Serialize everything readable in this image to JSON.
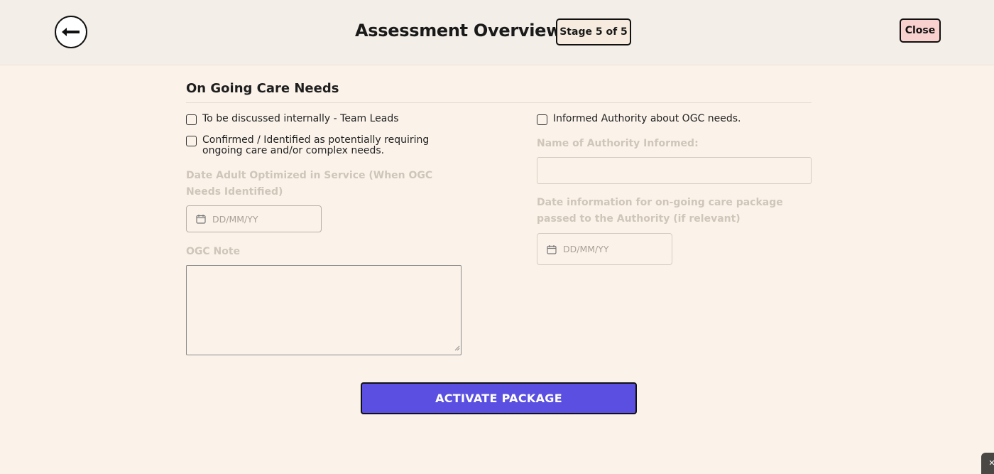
{
  "header": {
    "title": "Assessment Overview",
    "stage": "Stage 5 of 5",
    "close_label": "Close"
  },
  "section": {
    "title": "On Going Care Needs"
  },
  "left": {
    "check_internal": "To be discussed internally - Team Leads",
    "check_confirmed": "Confirmed / Identified as potentially requiring ongoing care and/or complex needs.",
    "date_optimized_label": "Date Adult Optimized in Service (When OGC Needs Identified)",
    "date_optimized_placeholder": "DD/MM/YY",
    "ogc_note_label": "OGC Note"
  },
  "right": {
    "check_informed": "Informed Authority about OGC needs.",
    "authority_name_label": "Name of Authority Informed:",
    "date_passed_label": "Date information for on-going care package passed to the Authority (if relevant)",
    "date_passed_placeholder": "DD/MM/YY"
  },
  "actions": {
    "activate_label": "ACTIVATE PACKAGE"
  },
  "icons": {
    "back": "arrow-left-icon",
    "calendar": "calendar-icon",
    "corner": "close-icon"
  },
  "colors": {
    "accent": "#5a4fe0",
    "close_bg": "#f8d0cd",
    "page_bg": "#fbf3ea",
    "header_bg": "#f3eee7"
  }
}
